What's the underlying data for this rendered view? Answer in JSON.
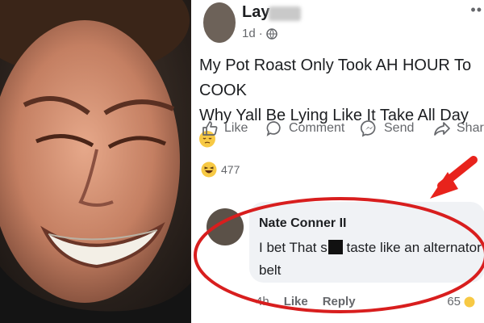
{
  "post": {
    "author_name": "Lay",
    "time": "1d",
    "privacy_icon": "globe-icon",
    "more_label": "••",
    "text_line1": "My Pot Roast Only Took AH HOUR To COOK",
    "text_line2": "Why Yall Be Lying Like It Take All Day",
    "text_emoji": "sleepy-face-emoji"
  },
  "actions": {
    "like": "Like",
    "comment": "Comment",
    "send": "Send",
    "share": "Shar"
  },
  "reactions": {
    "icon": "laughing-emoji",
    "count": "477"
  },
  "comment": {
    "author": "Nate Conner II",
    "text_part1": "I bet That s",
    "text_part2": "taste like an alternator belt",
    "time": "4h",
    "like": "Like",
    "reply": "Reply",
    "reaction_count": "65"
  },
  "annotations": {
    "arrow_color": "#e8231c",
    "circle_color": "#d81e1e"
  },
  "colors": {
    "text": "#1c1e21",
    "secondary": "#65676b",
    "bubble": "#f0f2f5"
  }
}
